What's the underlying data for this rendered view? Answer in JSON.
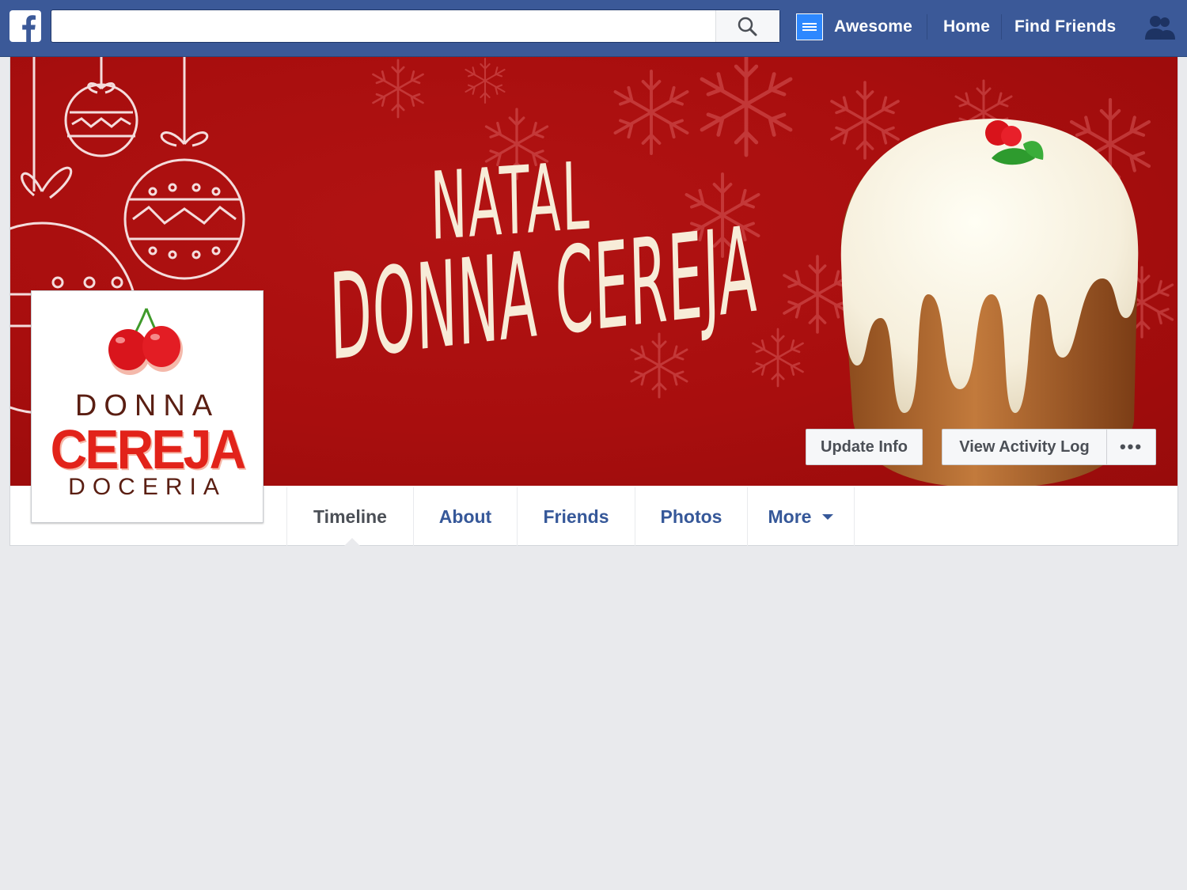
{
  "topbar": {
    "search": {
      "value": "",
      "placeholder": ""
    },
    "profile_name": "Awesome",
    "home_label": "Home",
    "find_friends_label": "Find Friends"
  },
  "cover": {
    "title_line1": "NATAL",
    "title_line2": "DONNA CEREJA",
    "actions": {
      "update_info": "Update Info",
      "view_activity_log": "View Activity Log",
      "more": "•••"
    }
  },
  "profile_picture": {
    "line1": "DONNA",
    "line2": "CEREJA",
    "line3": "DOCERIA"
  },
  "tabs": [
    {
      "label": "Timeline",
      "active": true
    },
    {
      "label": "About"
    },
    {
      "label": "Friends"
    },
    {
      "label": "Photos"
    },
    {
      "label": "More"
    }
  ],
  "colors": {
    "facebook_blue": "#3b5998",
    "cover_red": "#a80e0e",
    "link_blue": "#365899",
    "page_background": "#e9eaed"
  },
  "icons": [
    "facebook-logo-icon",
    "search-icon",
    "friend-requests-icon",
    "chevron-down-icon"
  ]
}
